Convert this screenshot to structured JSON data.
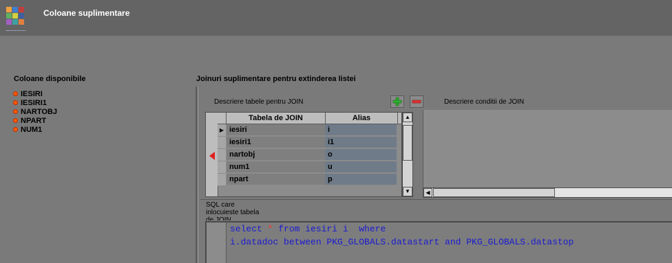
{
  "window": {
    "title": "Coloane suplimentare"
  },
  "left": {
    "label": "Coloane disponibile",
    "items": [
      "IESIRI",
      "IESIRI1",
      "NARTOBJ",
      "NPART",
      "NUM1"
    ]
  },
  "joins": {
    "section_label": "Joinuri suplimentare pentru extinderea listei",
    "tables_label": "Descriere tabele pentru JOIN",
    "conditions_label": "Descriere conditii de JOIN",
    "columns": [
      "Tabela de JOIN",
      "Alias"
    ],
    "rows": [
      {
        "table": "iesiri",
        "alias": "i"
      },
      {
        "table": "iesiri1",
        "alias": "i1"
      },
      {
        "table": "nartobj",
        "alias": "o"
      },
      {
        "table": "num1",
        "alias": "u"
      },
      {
        "table": "npart",
        "alias": "p"
      }
    ]
  },
  "sql": {
    "label_line1": "SQL care",
    "label_line2": "inlocuieste tabela",
    "label_line3": "de JOIN",
    "line1_a": "select ",
    "line1_star": "*",
    "line1_b": " from iesiri i  where",
    "line2": "i.datadoc between PKG_GLOBALS.datastart and PKG_GLOBALS.datastop"
  },
  "colors": {
    "accent_green": "#2fae2f",
    "accent_red": "#e03030",
    "sql_blue": "#1b1bd0",
    "bullet_orange": "#ff5a00"
  }
}
